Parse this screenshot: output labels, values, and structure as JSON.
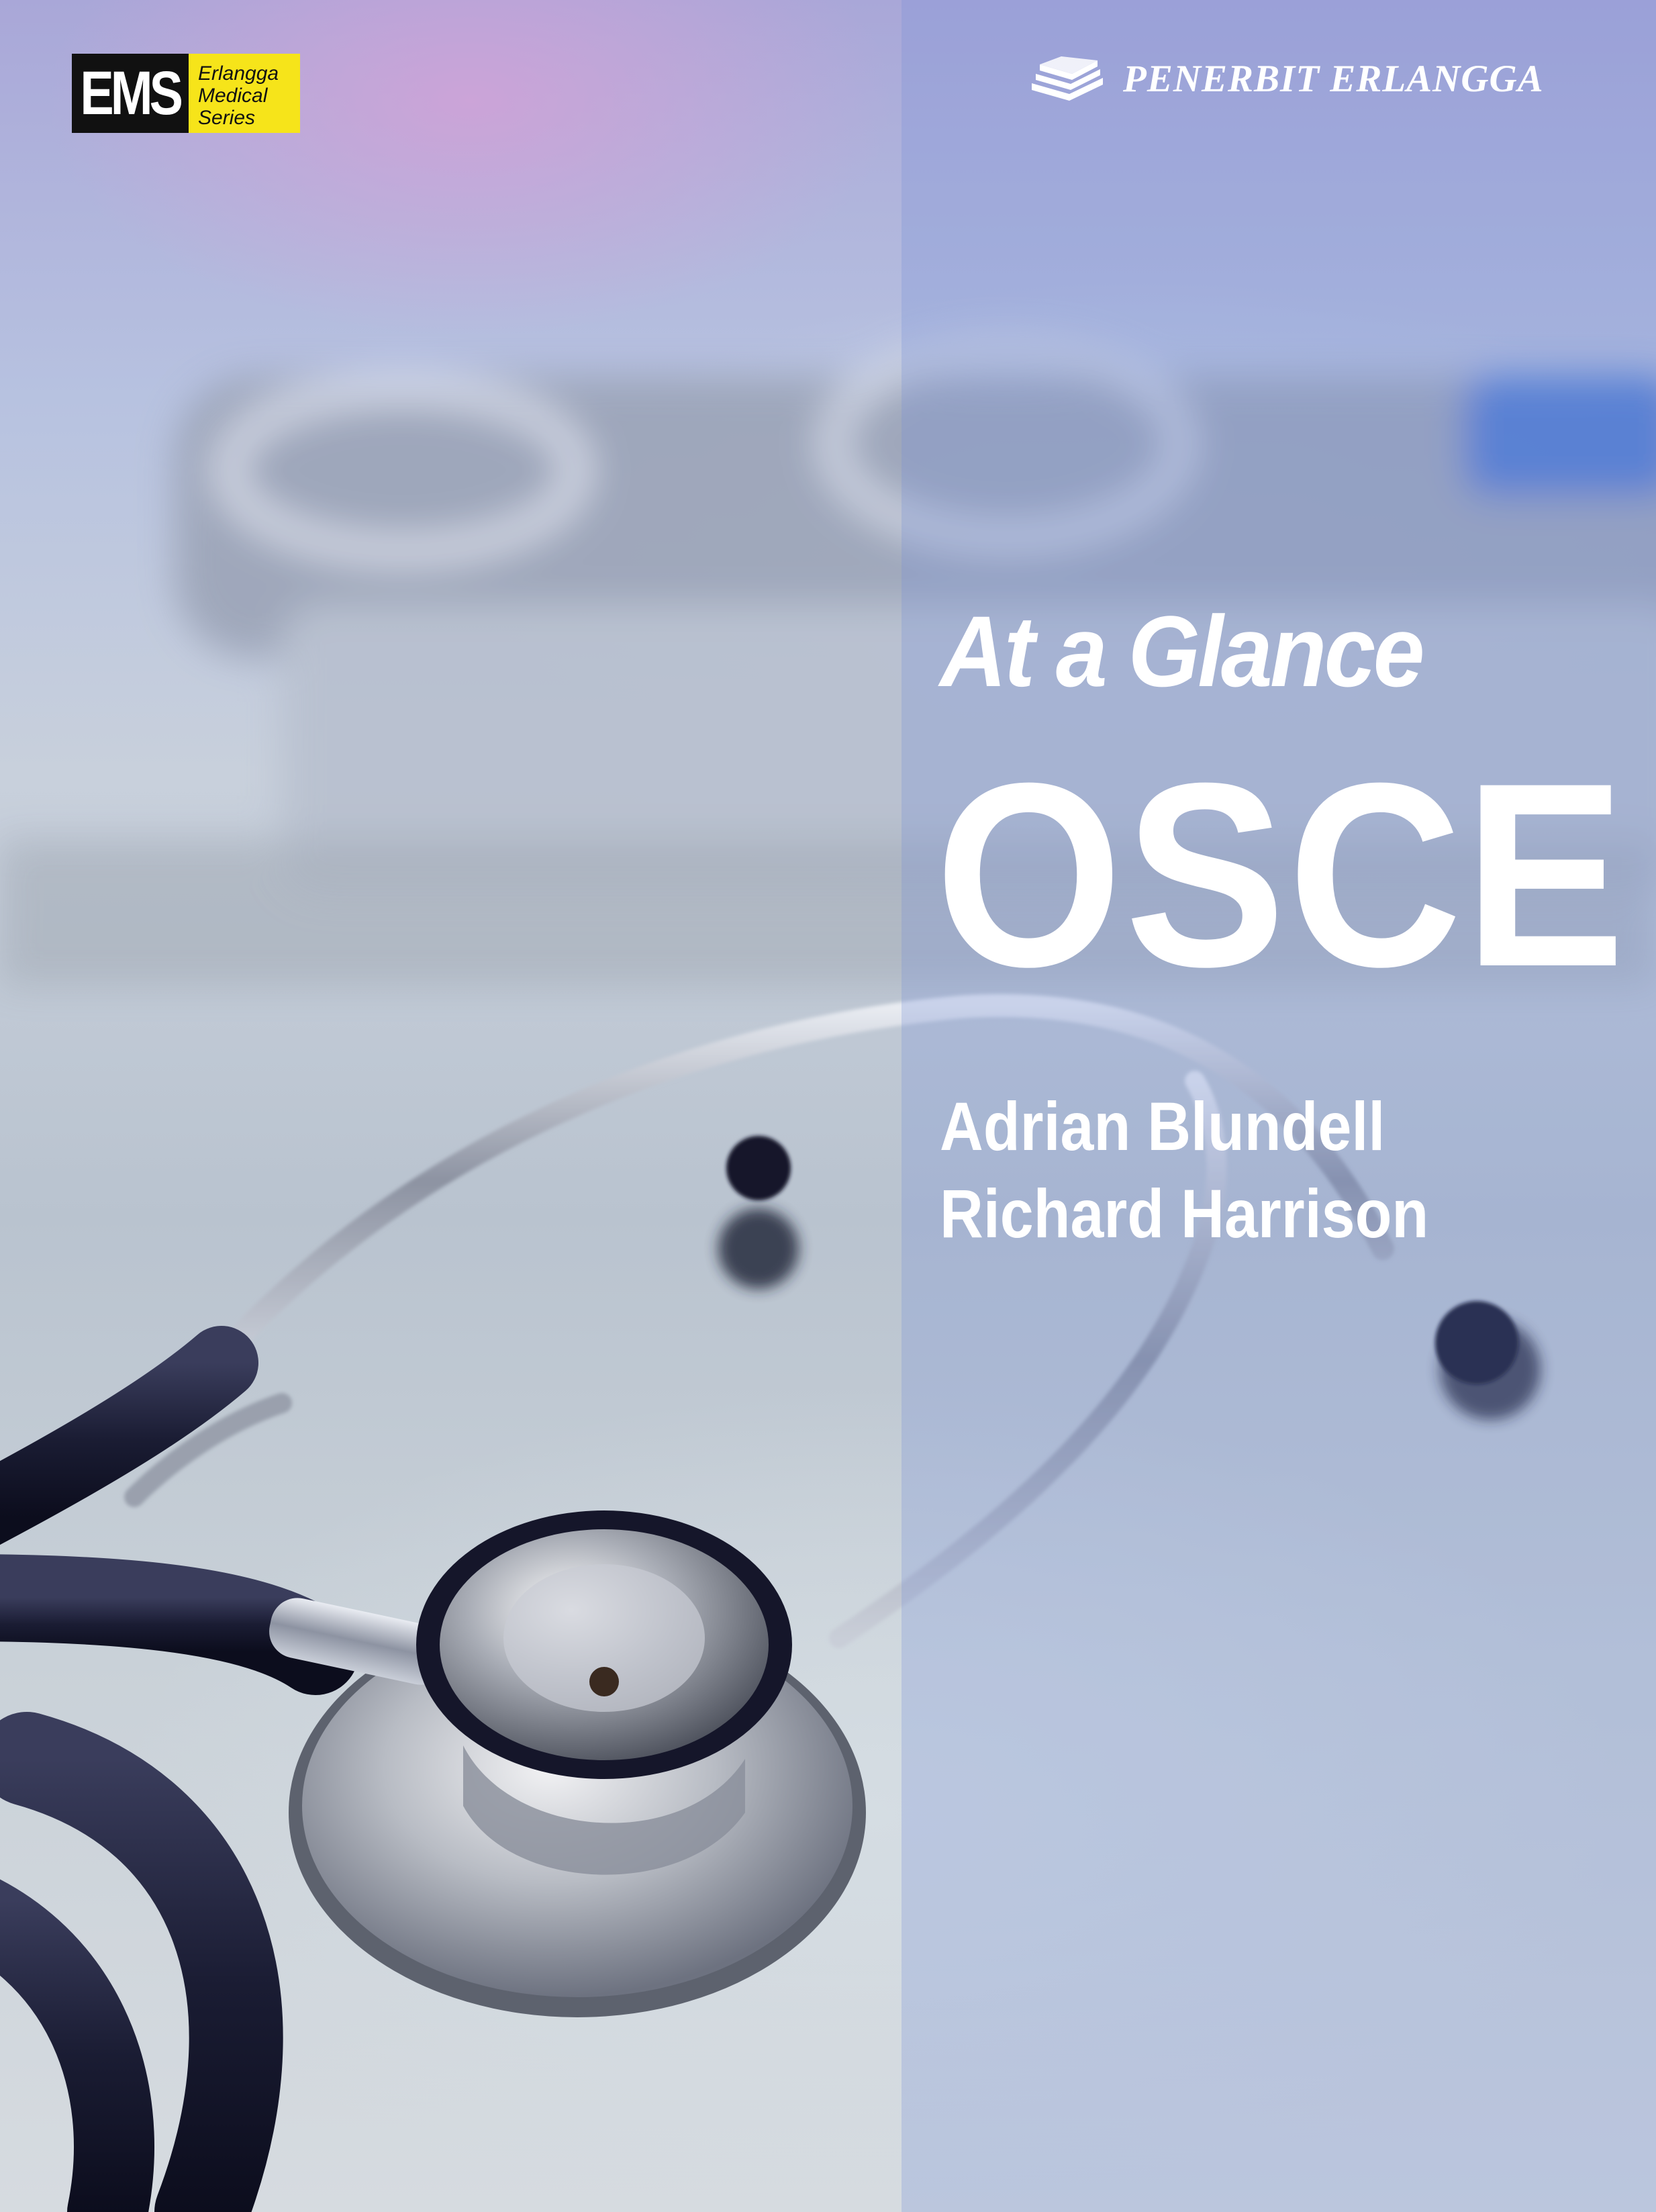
{
  "series_badge": {
    "abbr": "EMS",
    "line1": "Erlangga",
    "line2": "Medical",
    "line3": "Series"
  },
  "publisher": {
    "name": "PENERBIT ERLANGGA",
    "logo_icon": "stacked-books-icon"
  },
  "book": {
    "series_title": "At a Glance",
    "title": "OSCE",
    "authors": [
      "Adrian Blundell",
      "Richard Harrison"
    ]
  },
  "colors": {
    "badge_black": "#111111",
    "badge_yellow": "#f6e41a",
    "title_text": "#ffffff",
    "panel_tint": "#7891d7"
  }
}
